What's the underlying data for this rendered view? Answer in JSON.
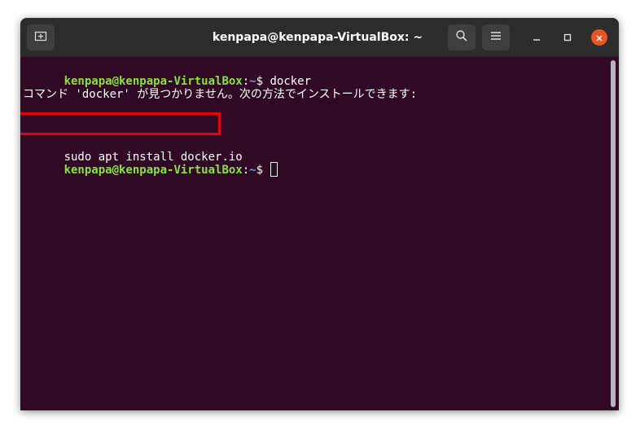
{
  "window": {
    "title": "kenpapa@kenpapa-VirtualBox: ~"
  },
  "titlebar": {
    "icons": [
      "new-tab-icon",
      "search-icon",
      "hamburger-menu-icon",
      "minimize-icon",
      "maximize-icon",
      "close-icon"
    ]
  },
  "terminal": {
    "prompt_user": "kenpapa@kenpapa-VirtualBox",
    "prompt_path": "~",
    "prompt_symbol": "$ ",
    "colon": ":",
    "lines": [
      {
        "type": "command",
        "command": "docker"
      },
      {
        "type": "output",
        "text": "コマンド 'docker' が見つかりません。次の方法でインストールできます:"
      },
      {
        "type": "output",
        "text": "sudo apt install docker.io",
        "highlighted": true
      },
      {
        "type": "command",
        "command": ""
      }
    ]
  },
  "colors": {
    "background": "#300a24",
    "titlebar": "#2c2c2c",
    "prompt_user": "#8ae234",
    "prompt_path": "#729fcf",
    "highlight_box": "#e8000d",
    "close_button": "#e95420"
  }
}
